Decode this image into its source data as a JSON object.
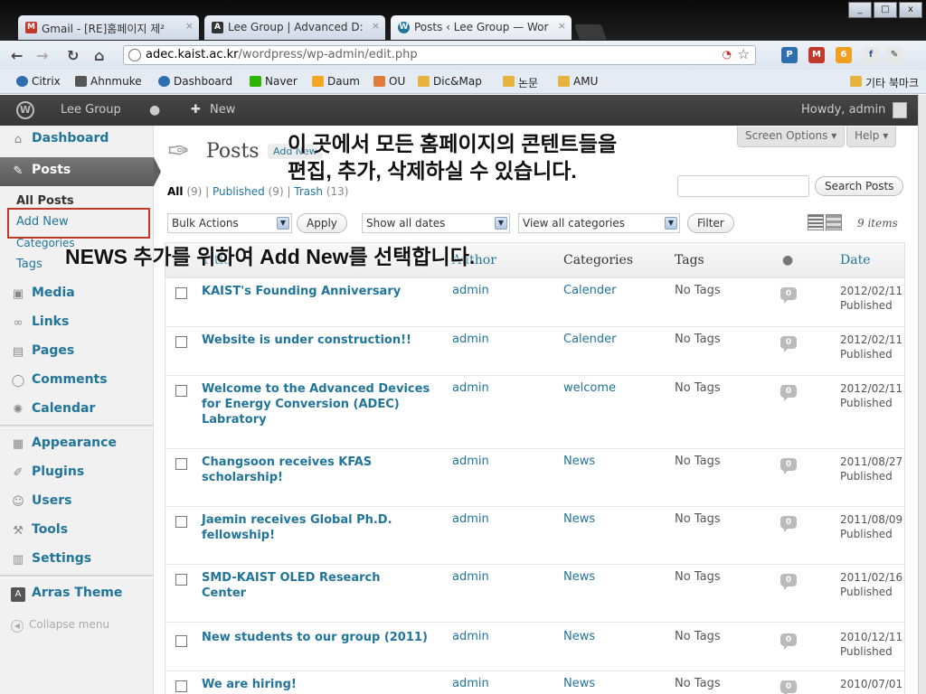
{
  "browser": {
    "tabs": [
      {
        "label": "Gmail - [RE]홈페이지 제²",
        "icon": "gmail-icon",
        "icon_glyph": "M",
        "color": "#c0392b"
      },
      {
        "label": "Lee Group | Advanced D:",
        "icon": "arras-icon",
        "icon_glyph": "A",
        "color": "#333333"
      },
      {
        "label": "Posts ‹ Lee Group — Wor",
        "icon": "wordpress-icon",
        "icon_glyph": "W",
        "color": "#21759b"
      }
    ],
    "url_host": "adec.kaist.ac.kr",
    "url_path": "/wordpress/wp-admin/edit.php",
    "bookmarks": [
      {
        "label": "Citrix",
        "color": "#2f6fb0"
      },
      {
        "label": "Ahnmuke",
        "color": "#555555"
      },
      {
        "label": "Dashboard",
        "color": "#2f6fb0"
      },
      {
        "label": "Naver",
        "color": "#2db400"
      },
      {
        "label": "Daum",
        "color": "#f5a623"
      },
      {
        "label": "OU",
        "color": "#e07b39"
      },
      {
        "label": "Dic&Map",
        "color": "#e6b43c"
      },
      {
        "label": "논문",
        "color": "#e6b43c"
      },
      {
        "label": "AMU",
        "color": "#e6b43c"
      }
    ],
    "other_bookmarks": "기타 북마크",
    "window_buttons": [
      "_",
      "□",
      "x"
    ]
  },
  "adminbar": {
    "site_name": "Lee Group",
    "new_label": "New",
    "howdy": "Howdy, admin"
  },
  "sidebar": {
    "menu": [
      {
        "label": "Dashboard",
        "icon": "dashboard-icon",
        "glyph": "⌂"
      },
      {
        "label": "Posts",
        "icon": "pushpin-icon",
        "glyph": "✎"
      },
      {
        "label": "Media",
        "icon": "media-icon",
        "glyph": "▣"
      },
      {
        "label": "Links",
        "icon": "links-icon",
        "glyph": "∞"
      },
      {
        "label": "Pages",
        "icon": "pages-icon",
        "glyph": "▤"
      },
      {
        "label": "Comments",
        "icon": "comments-icon",
        "glyph": "◯"
      },
      {
        "label": "Calendar",
        "icon": "calendar-icon",
        "glyph": "✺"
      },
      {
        "label": "Appearance",
        "icon": "appearance-icon",
        "glyph": "▦"
      },
      {
        "label": "Plugins",
        "icon": "plugins-icon",
        "glyph": "✐"
      },
      {
        "label": "Users",
        "icon": "users-icon",
        "glyph": "☺"
      },
      {
        "label": "Tools",
        "icon": "tools-icon",
        "glyph": "⚒"
      },
      {
        "label": "Settings",
        "icon": "settings-icon",
        "glyph": "▥"
      },
      {
        "label": "Arras Theme",
        "icon": "arras-theme-icon",
        "glyph": "A"
      }
    ],
    "submenu": [
      "All Posts",
      "Add New",
      "Categories",
      "Tags"
    ],
    "collapse": "Collapse menu"
  },
  "main": {
    "title": "Posts",
    "add_new": "Add New",
    "screen_options": "Screen Options",
    "help": "Help",
    "filters": {
      "all": "All",
      "all_count": "(9)",
      "published": "Published",
      "published_count": "(9)",
      "trash": "Trash",
      "trash_count": "(13)"
    },
    "search_button": "Search Posts",
    "bulk_actions": "Bulk Actions",
    "apply": "Apply",
    "show_all_dates": "Show all dates",
    "view_all_categories": "View all categories",
    "filter": "Filter",
    "item_count": "9 items",
    "columns": {
      "title": "Title",
      "author": "Author",
      "categories": "Categories",
      "tags": "Tags",
      "date": "Date"
    },
    "rows": [
      {
        "title": "KAIST's Founding Anniversary",
        "author": "admin",
        "category": "Calender",
        "tags": "No Tags",
        "comments": "0",
        "date": "2012/02/11",
        "status": "Published"
      },
      {
        "title": "Website is under construction!!",
        "author": "admin",
        "category": "Calender",
        "tags": "No Tags",
        "comments": "0",
        "date": "2012/02/11",
        "status": "Published"
      },
      {
        "title": "Welcome to the Advanced Devices for Energy Conversion (ADEC) Labratory",
        "author": "admin",
        "category": "welcome",
        "tags": "No Tags",
        "comments": "0",
        "date": "2012/02/11",
        "status": "Published"
      },
      {
        "title": "Changsoon receives KFAS scholarship!",
        "author": "admin",
        "category": "News",
        "tags": "No Tags",
        "comments": "0",
        "date": "2011/08/27",
        "status": "Published"
      },
      {
        "title": "Jaemin receives Global Ph.D. fellowship!",
        "author": "admin",
        "category": "News",
        "tags": "No Tags",
        "comments": "0",
        "date": "2011/08/09",
        "status": "Published"
      },
      {
        "title": "SMD-KAIST OLED Research Center",
        "author": "admin",
        "category": "News",
        "tags": "No Tags",
        "comments": "0",
        "date": "2011/02/16",
        "status": "Published"
      },
      {
        "title": "New students to our group (2011)",
        "author": "admin",
        "category": "News",
        "tags": "No Tags",
        "comments": "0",
        "date": "2010/12/11",
        "status": "Published"
      },
      {
        "title": "We are hiring!",
        "author": "admin",
        "category": "News",
        "tags": "No Tags",
        "comments": "0",
        "date": "2010/07/01",
        "status": ""
      }
    ]
  },
  "annotations": {
    "top_line1": "이 곳에서 모든 홈페이지의 콘텐트들을",
    "top_line2": "편집, 추가, 삭제하실 수 있습니다.",
    "news": "NEWS 추가를 위하여 Add New를 선택합니다."
  }
}
